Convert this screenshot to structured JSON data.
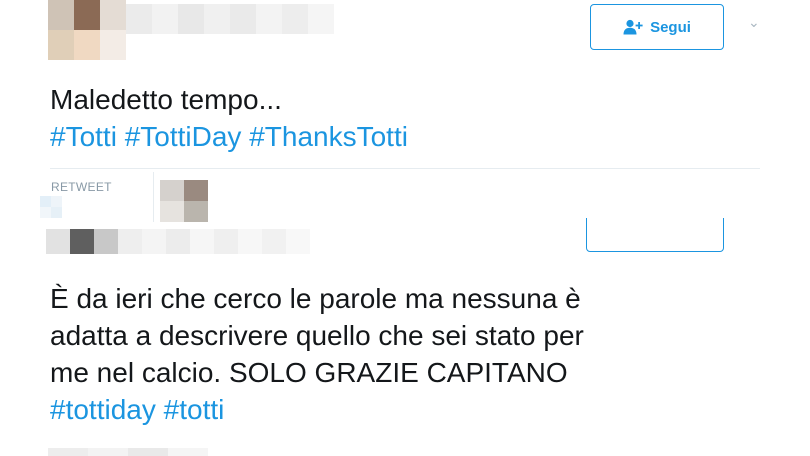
{
  "tweet1": {
    "follow_label": "Segui",
    "text": "Maledetto tempo...",
    "hashtags": [
      "#Totti",
      "#TottiDay",
      "#ThanksTotti"
    ],
    "retweet_label": "RETWEET"
  },
  "tweet2": {
    "text_lines": [
      "È da ieri che cerco le parole ma nessuna è",
      "adatta a descrivere quello che sei stato per",
      "me nel calcio. SOLO GRAZIE CAPITANO"
    ],
    "hashtags": [
      "#tottiday",
      "#totti"
    ]
  },
  "colors": {
    "link": "#1b95e0",
    "text": "#14171a",
    "muted": "#8899a6",
    "divider": "#e6ecf0"
  },
  "icons": {
    "follow": "add-user-icon",
    "menu": "chevron-down-icon"
  }
}
